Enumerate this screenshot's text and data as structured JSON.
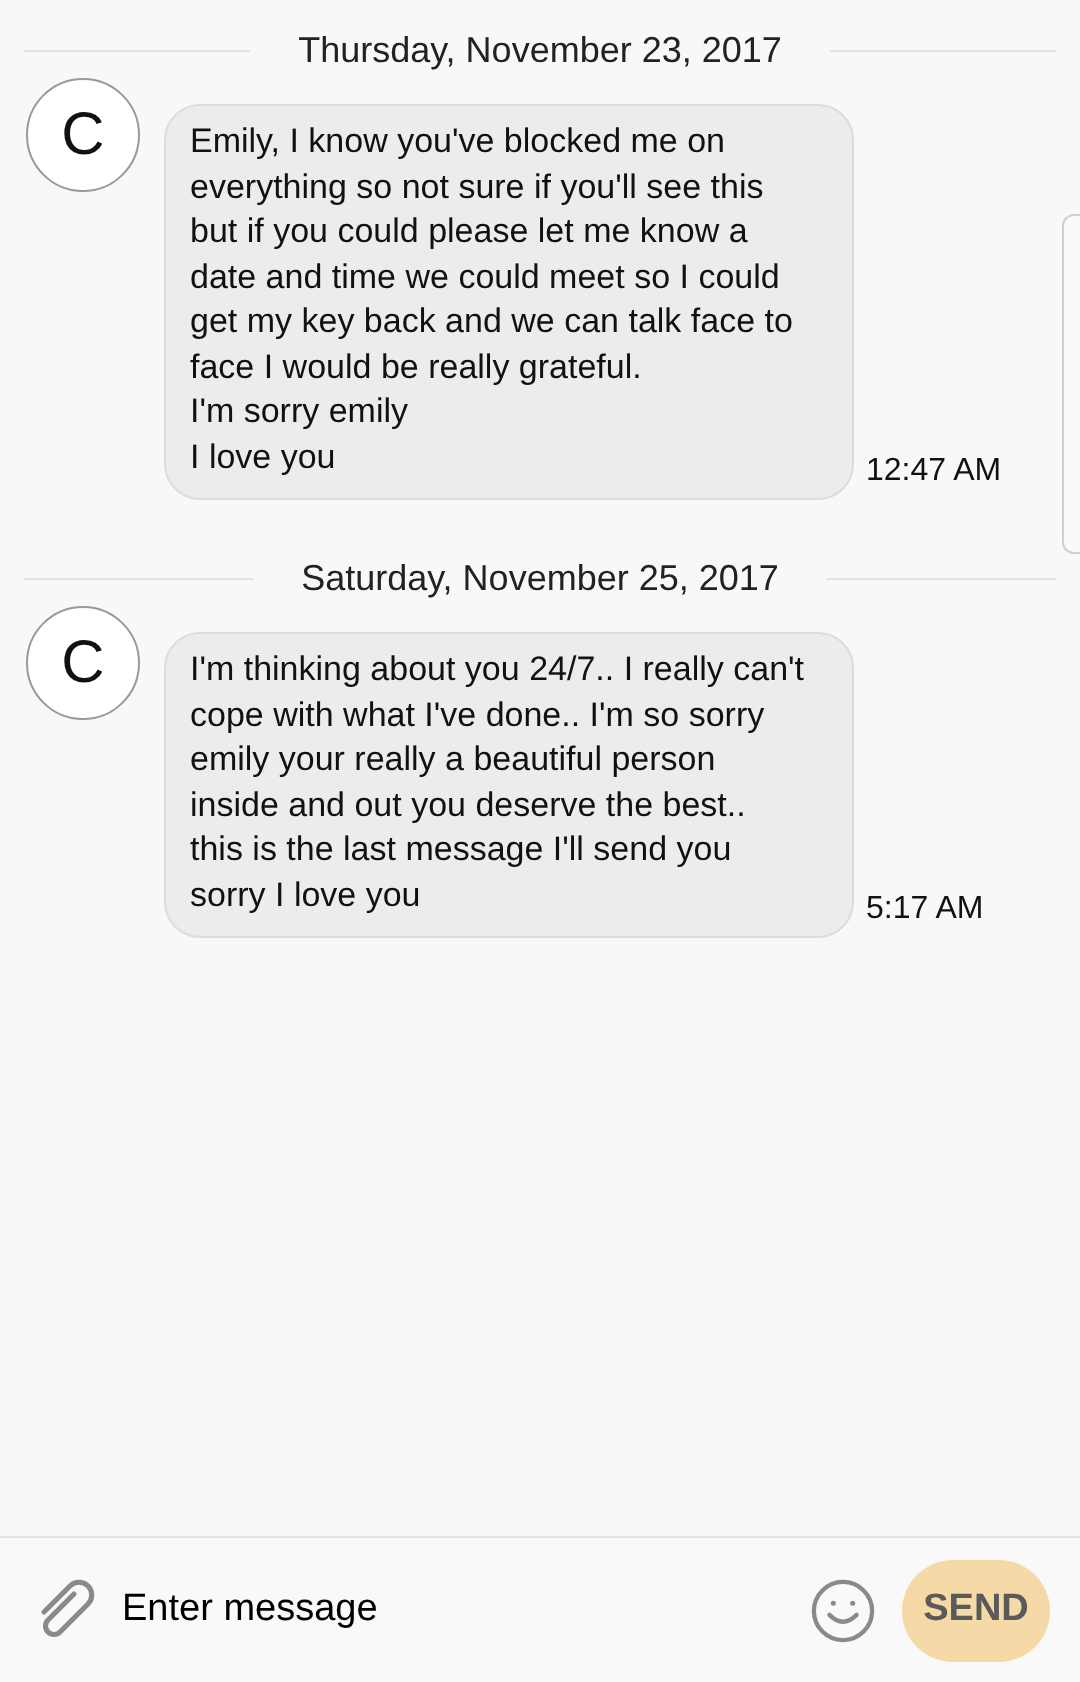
{
  "conversation": [
    {
      "date": "Thursday, November 23, 2017",
      "avatar": "C",
      "message": "Emily, I know you've blocked me on everything so not sure if you'll see this but if you could please let me know a date and time we could meet so I could get my key back and we can talk face to face I would be really grateful.\nI'm sorry emily\nI love you",
      "time": "12:47 AM"
    },
    {
      "date": "Saturday, November 25, 2017",
      "avatar": "C",
      "message": "I'm thinking about you 24/7.. I really can't cope with what I've done.. I'm so sorry emily your really a beautiful person inside and out you deserve the best.. this is the last message I'll send you sorry I love you",
      "time": "5:17 AM"
    }
  ],
  "composer": {
    "placeholder": "Enter message",
    "send": "SEND"
  }
}
